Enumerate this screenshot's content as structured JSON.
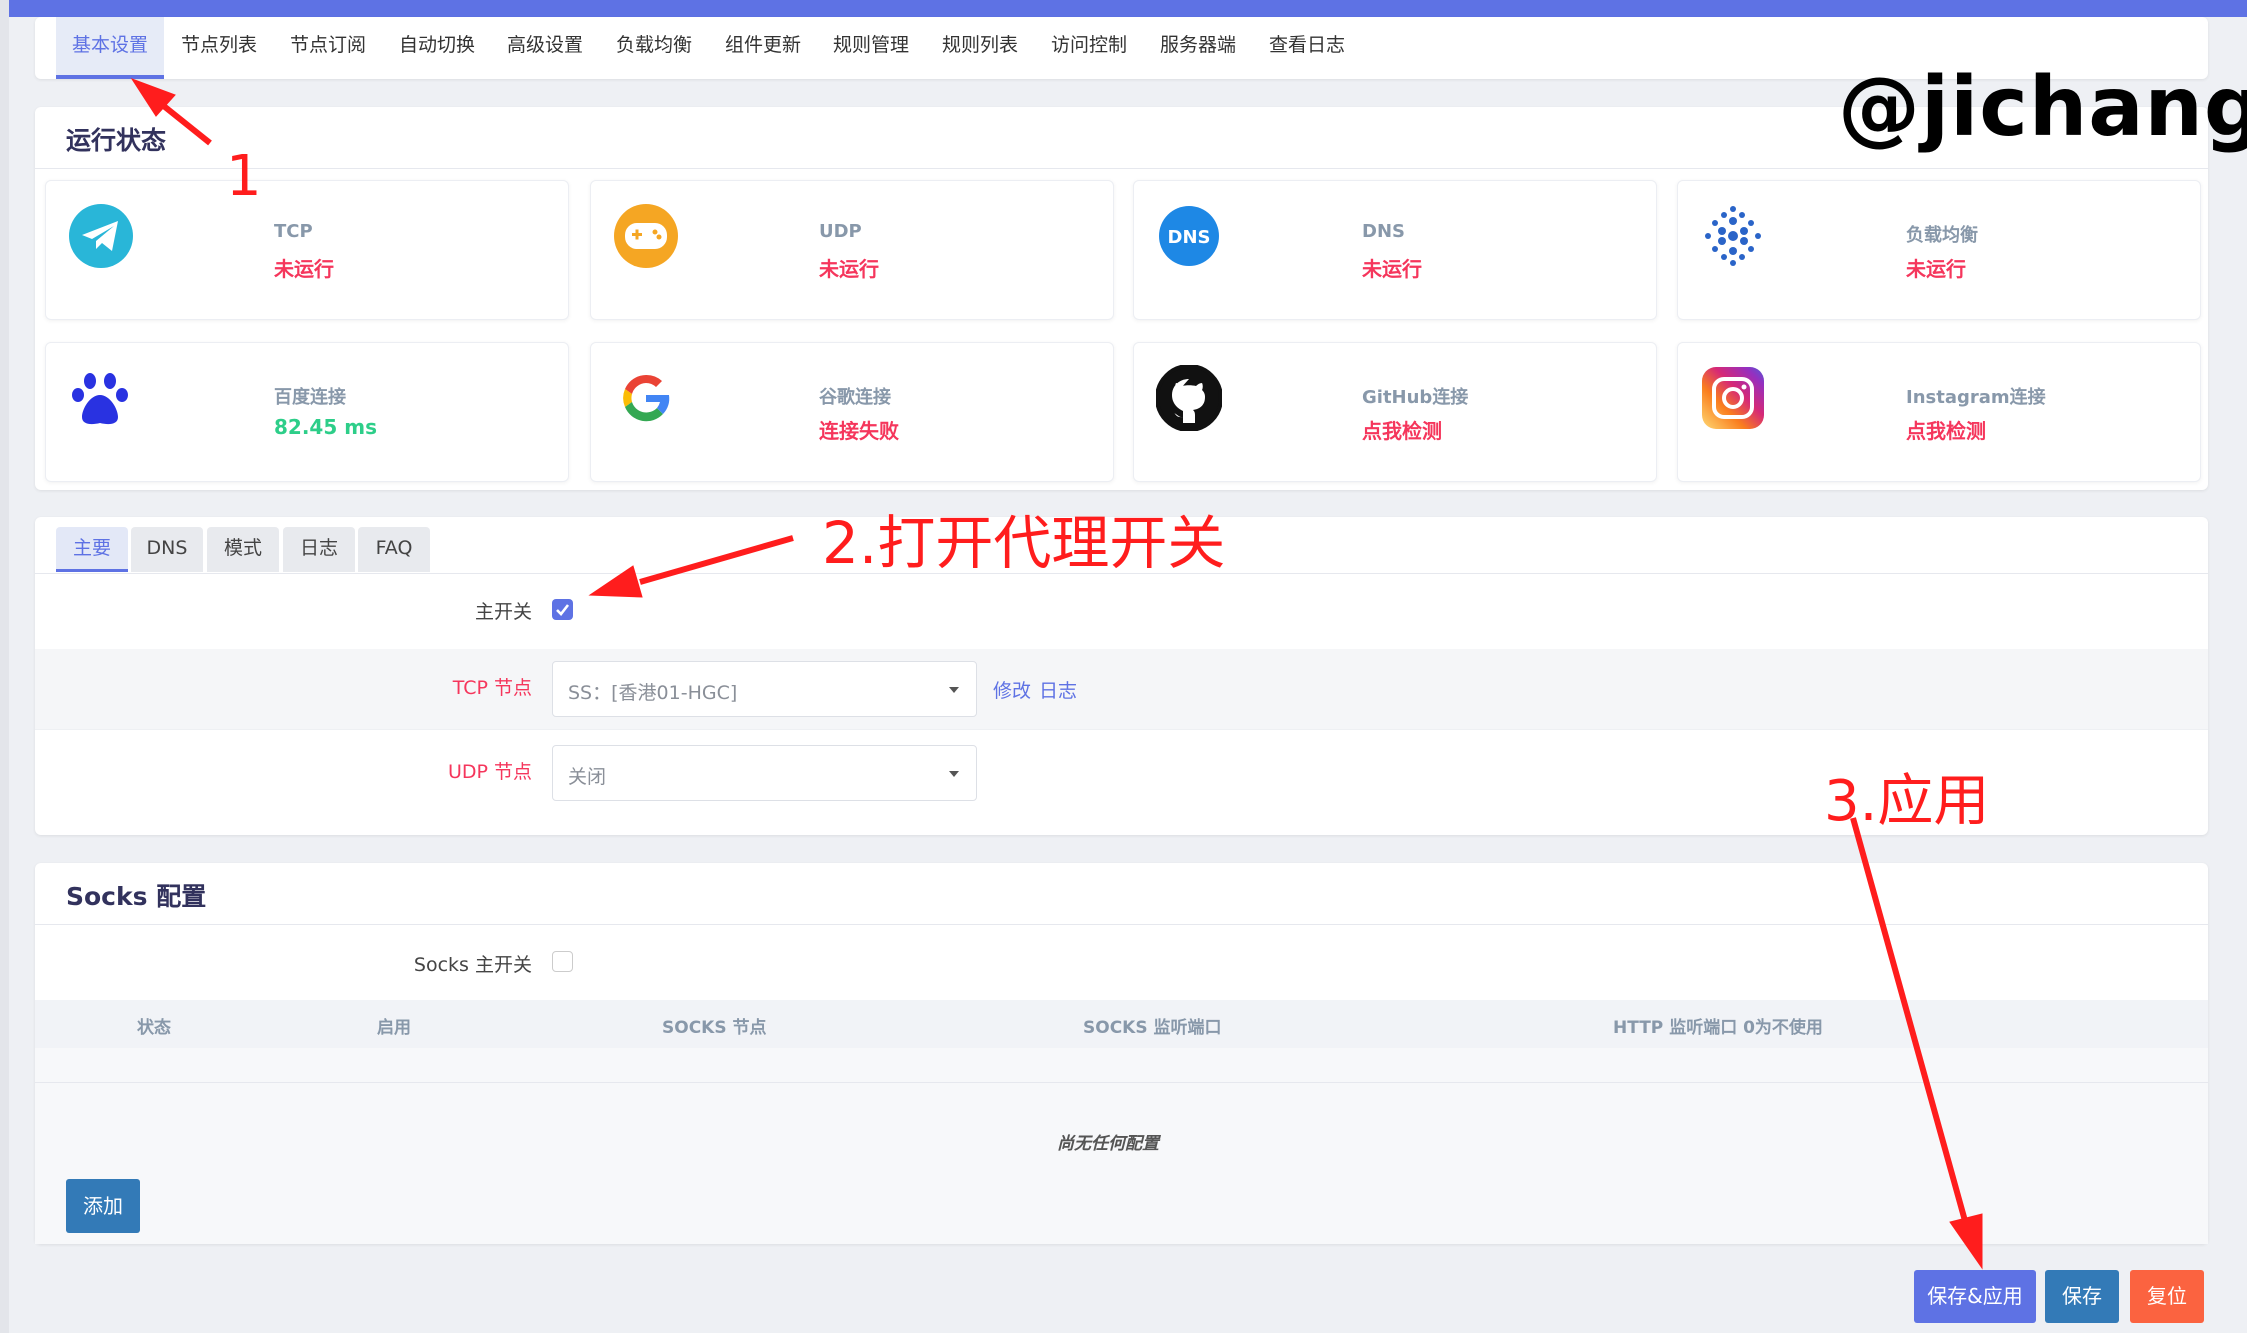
{
  "nav": {
    "tabs": [
      {
        "label": "基本设置",
        "active": true
      },
      {
        "label": "节点列表"
      },
      {
        "label": "节点订阅"
      },
      {
        "label": "自动切换"
      },
      {
        "label": "高级设置"
      },
      {
        "label": "负载均衡"
      },
      {
        "label": "组件更新"
      },
      {
        "label": "规则管理"
      },
      {
        "label": "规则列表"
      },
      {
        "label": "访问控制"
      },
      {
        "label": "服务器端"
      },
      {
        "label": "查看日志"
      }
    ]
  },
  "status": {
    "title": "运行状态",
    "cards": [
      {
        "icon": "telegram-icon",
        "label": "TCP",
        "value": "未运行",
        "state": "bad"
      },
      {
        "icon": "gamepad-icon",
        "label": "UDP",
        "value": "未运行",
        "state": "bad"
      },
      {
        "icon": "dns-icon",
        "icon_text": "DNS",
        "label": "DNS",
        "value": "未运行",
        "state": "bad"
      },
      {
        "icon": "load-balance-icon",
        "label": "负载均衡",
        "value": "未运行",
        "state": "bad"
      },
      {
        "icon": "baidu-paw-icon",
        "label": "百度连接",
        "value": "82.45 ms",
        "state": "good"
      },
      {
        "icon": "google-icon",
        "label": "谷歌连接",
        "value": "连接失败",
        "state": "bad"
      },
      {
        "icon": "github-icon",
        "label": "GitHub连接",
        "value": "点我检测",
        "state": "bad"
      },
      {
        "icon": "instagram-icon",
        "label": "Instagram连接",
        "value": "点我检测",
        "state": "bad"
      }
    ]
  },
  "main": {
    "subtabs": [
      {
        "label": "主要",
        "active": true
      },
      {
        "label": "DNS"
      },
      {
        "label": "模式"
      },
      {
        "label": "日志"
      },
      {
        "label": "FAQ"
      }
    ],
    "master_switch": {
      "label": "主开关",
      "checked": true
    },
    "tcp_node": {
      "label": "TCP 节点",
      "value": "SS：[香港01-HGC]",
      "edit_link": "修改",
      "log_link": "日志"
    },
    "udp_node": {
      "label": "UDP 节点",
      "value": "关闭"
    }
  },
  "socks": {
    "title": "Socks 配置",
    "switch": {
      "label": "Socks 主开关",
      "checked": false
    },
    "columns": [
      "状态",
      "启用",
      "SOCKS 节点",
      "SOCKS 监听端口",
      "HTTP 监听端口 0为不使用"
    ],
    "empty_text": "尚无任何配置",
    "add_button": "添加"
  },
  "footer": {
    "save_apply": "保存&应用",
    "save": "保存",
    "reset": "复位"
  },
  "annotations": {
    "step1": "1",
    "step2": "2.打开代理开关",
    "step3": "3.应用",
    "watermark": "@jichangtj"
  },
  "colors": {
    "accent": "#5e72e4",
    "danger": "#f5365c",
    "success": "#2dce89",
    "primary": "#337ab7",
    "warning": "#fb6340",
    "annotation": "#ff1d1d"
  }
}
